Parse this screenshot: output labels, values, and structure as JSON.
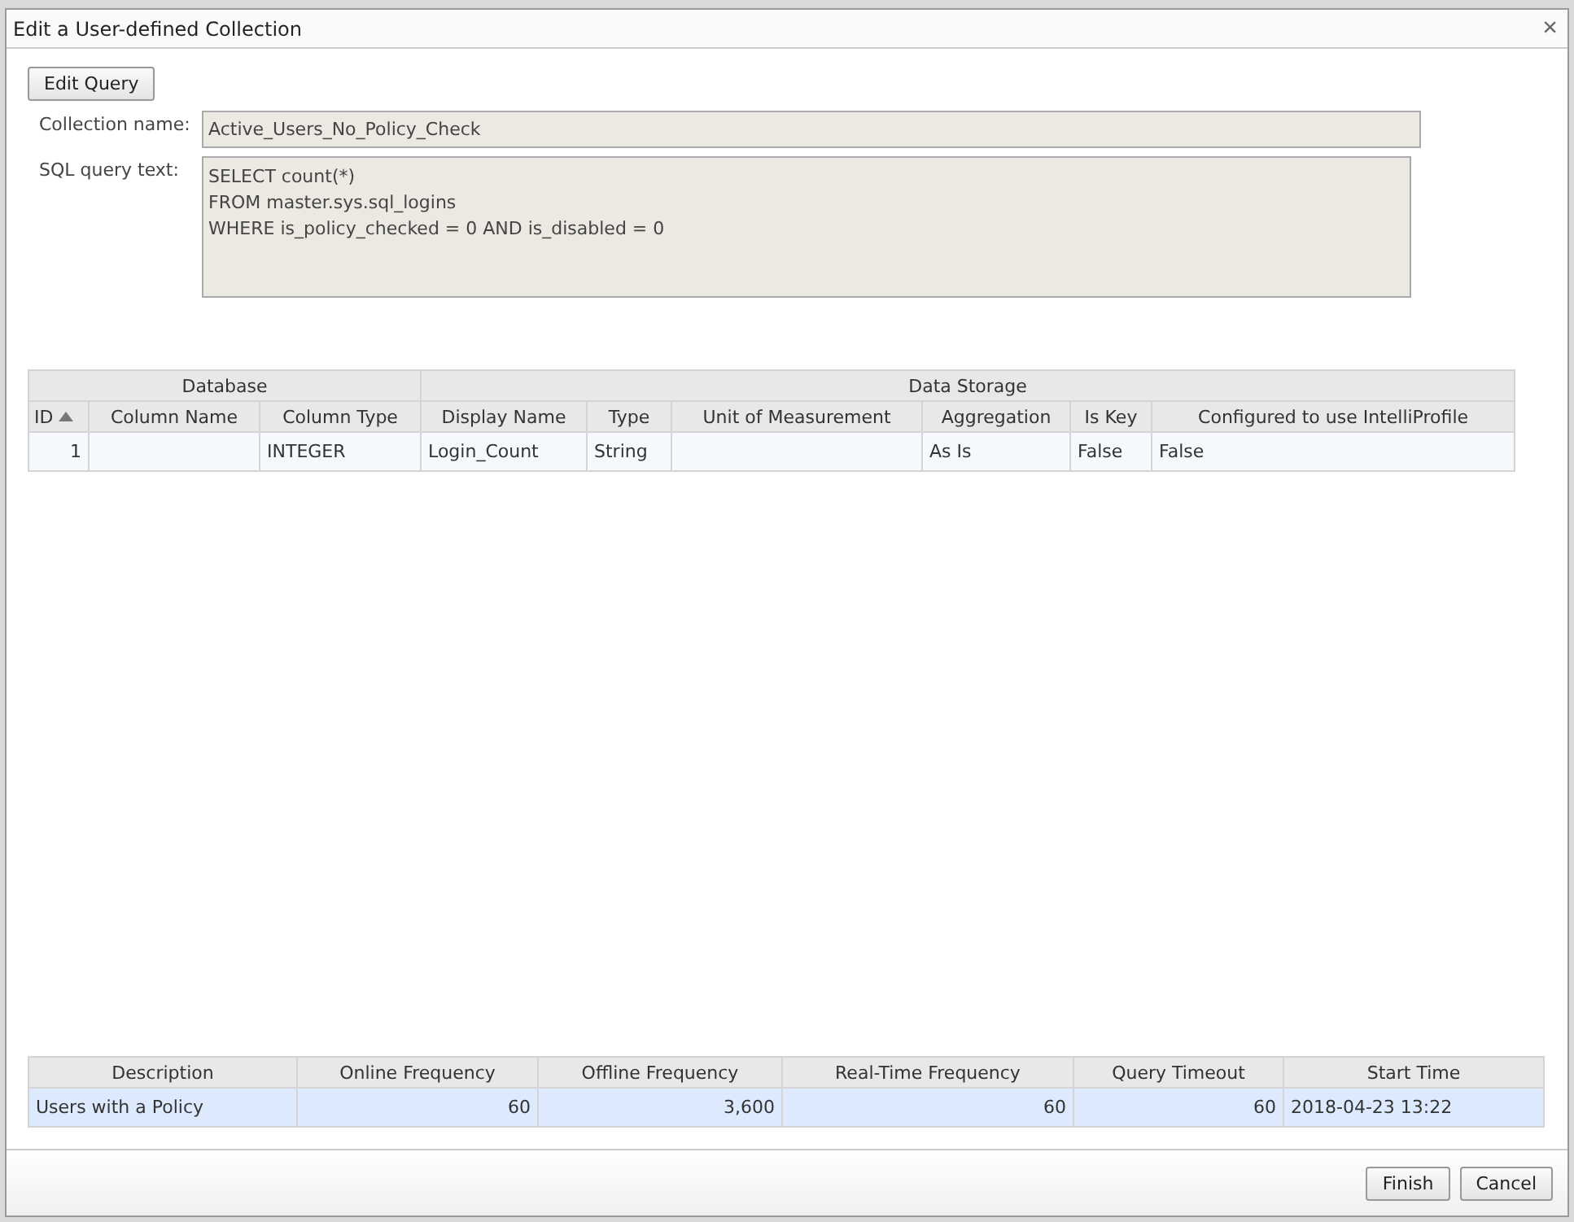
{
  "window": {
    "title": "Edit a User-defined Collection",
    "close": "×"
  },
  "edit_query_button": "Edit Query",
  "collection_name": {
    "label": "Collection name:",
    "value": "Active_Users_No_Policy_Check"
  },
  "sql_query": {
    "label": "SQL query text:",
    "lines": [
      "SELECT count(*)",
      "FROM master.sys.sql_logins",
      "WHERE is_policy_checked = 0 AND is_disabled = 0"
    ]
  },
  "columns_table": {
    "groups": [
      "Database",
      "Data Storage"
    ],
    "columns": [
      {
        "label": "ID",
        "sorted": true
      },
      {
        "label": "Column Name",
        "sorted": false
      },
      {
        "label": "Column Type",
        "sorted": false
      },
      {
        "label": "Display Name",
        "sorted": false
      },
      {
        "label": "Type",
        "sorted": false
      },
      {
        "label": "Unit of Measurement",
        "sorted": false
      },
      {
        "label": "Aggregation",
        "sorted": false
      },
      {
        "label": "Is Key",
        "sorted": false
      },
      {
        "label": "Configured to use IntelliProfile",
        "sorted": false
      }
    ],
    "rows": [
      {
        "selected": false,
        "cells": [
          "1",
          "",
          "INTEGER",
          "Login_Count",
          "String",
          "",
          "As Is",
          "False",
          "False"
        ]
      }
    ]
  },
  "schedule_table": {
    "columns": [
      "Description",
      "Online Frequency",
      "Offline Frequency",
      "Real-Time Frequency",
      "Query Timeout",
      "Start Time"
    ],
    "rows": [
      {
        "selected": true,
        "cells": [
          "Users with a Policy",
          "60",
          "3,600",
          "60",
          "60",
          "2018-04-23 13:22"
        ]
      }
    ]
  },
  "buttons": [
    "Finish",
    "Cancel"
  ]
}
